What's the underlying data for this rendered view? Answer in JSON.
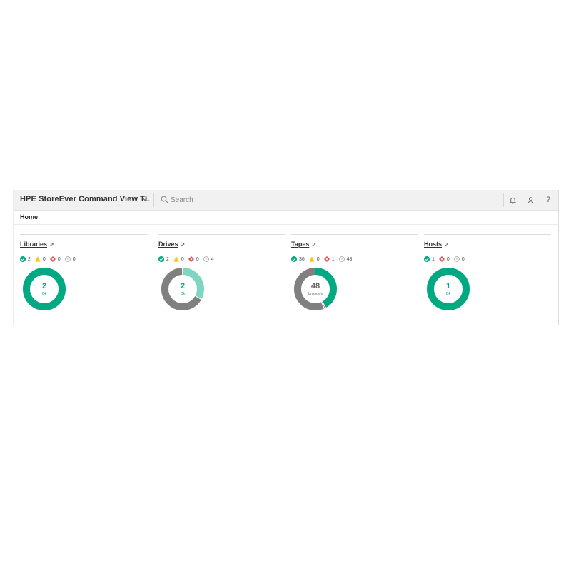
{
  "header": {
    "app_title": "HPE StoreEver Command View TL",
    "search_placeholder": "Search"
  },
  "breadcrumb": "Home",
  "colors": {
    "ok": "#01a982",
    "ok_light": "#7fd6c0",
    "unknown": "#808080",
    "warning": "#f5c518",
    "critical": "#e5484d"
  },
  "panels": [
    {
      "title": "Libraries",
      "arrow": ">",
      "stats": {
        "ok": "2",
        "warning": "0",
        "critical": "0",
        "unknown": "0"
      },
      "donut": {
        "value": "2",
        "label": "Ok",
        "segments": [
          {
            "status": "ok",
            "count": 2
          }
        ]
      }
    },
    {
      "title": "Drives",
      "arrow": ">",
      "stats": {
        "ok": "2",
        "warning": "0",
        "critical": "0",
        "unknown": "4"
      },
      "donut": {
        "value": "2",
        "label": "Ok",
        "segments": [
          {
            "status": "ok_light",
            "count": 2
          },
          {
            "status": "unknown",
            "count": 4
          }
        ]
      }
    },
    {
      "title": "Tapes",
      "arrow": ">",
      "stats": {
        "ok": "36",
        "warning": "0",
        "critical": "1",
        "unknown": "48"
      },
      "donut": {
        "value": "48",
        "label": "Unknown",
        "segments": [
          {
            "status": "ok",
            "count": 36
          },
          {
            "status": "critical",
            "count": 1
          },
          {
            "status": "unknown",
            "count": 48
          }
        ]
      }
    },
    {
      "title": "Hosts",
      "arrow": ">",
      "stats": {
        "ok": "1",
        "critical": "0",
        "unknown": "0"
      },
      "donut": {
        "value": "1",
        "label": "Ok",
        "segments": [
          {
            "status": "ok",
            "count": 1
          }
        ]
      }
    }
  ]
}
